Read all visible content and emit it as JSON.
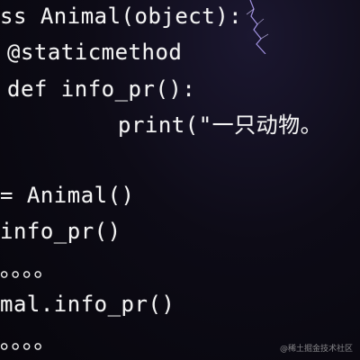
{
  "code": {
    "lines": [
      "ss Animal(object):",
      "@staticmethod",
      "def info_pr():",
      "print(\"一只动物。",
      "= Animal()",
      "info_pr()",
      "。。。。",
      "mal.info_pr()",
      "。。。。"
    ]
  },
  "watermark": {
    "text": "@稀土掘金技术社区"
  },
  "colors": {
    "code_text": "#f3f3f3",
    "background": "#0b0a13",
    "lightning": "#b8a7ff"
  },
  "icons": {
    "lightning": "lightning-icon"
  }
}
